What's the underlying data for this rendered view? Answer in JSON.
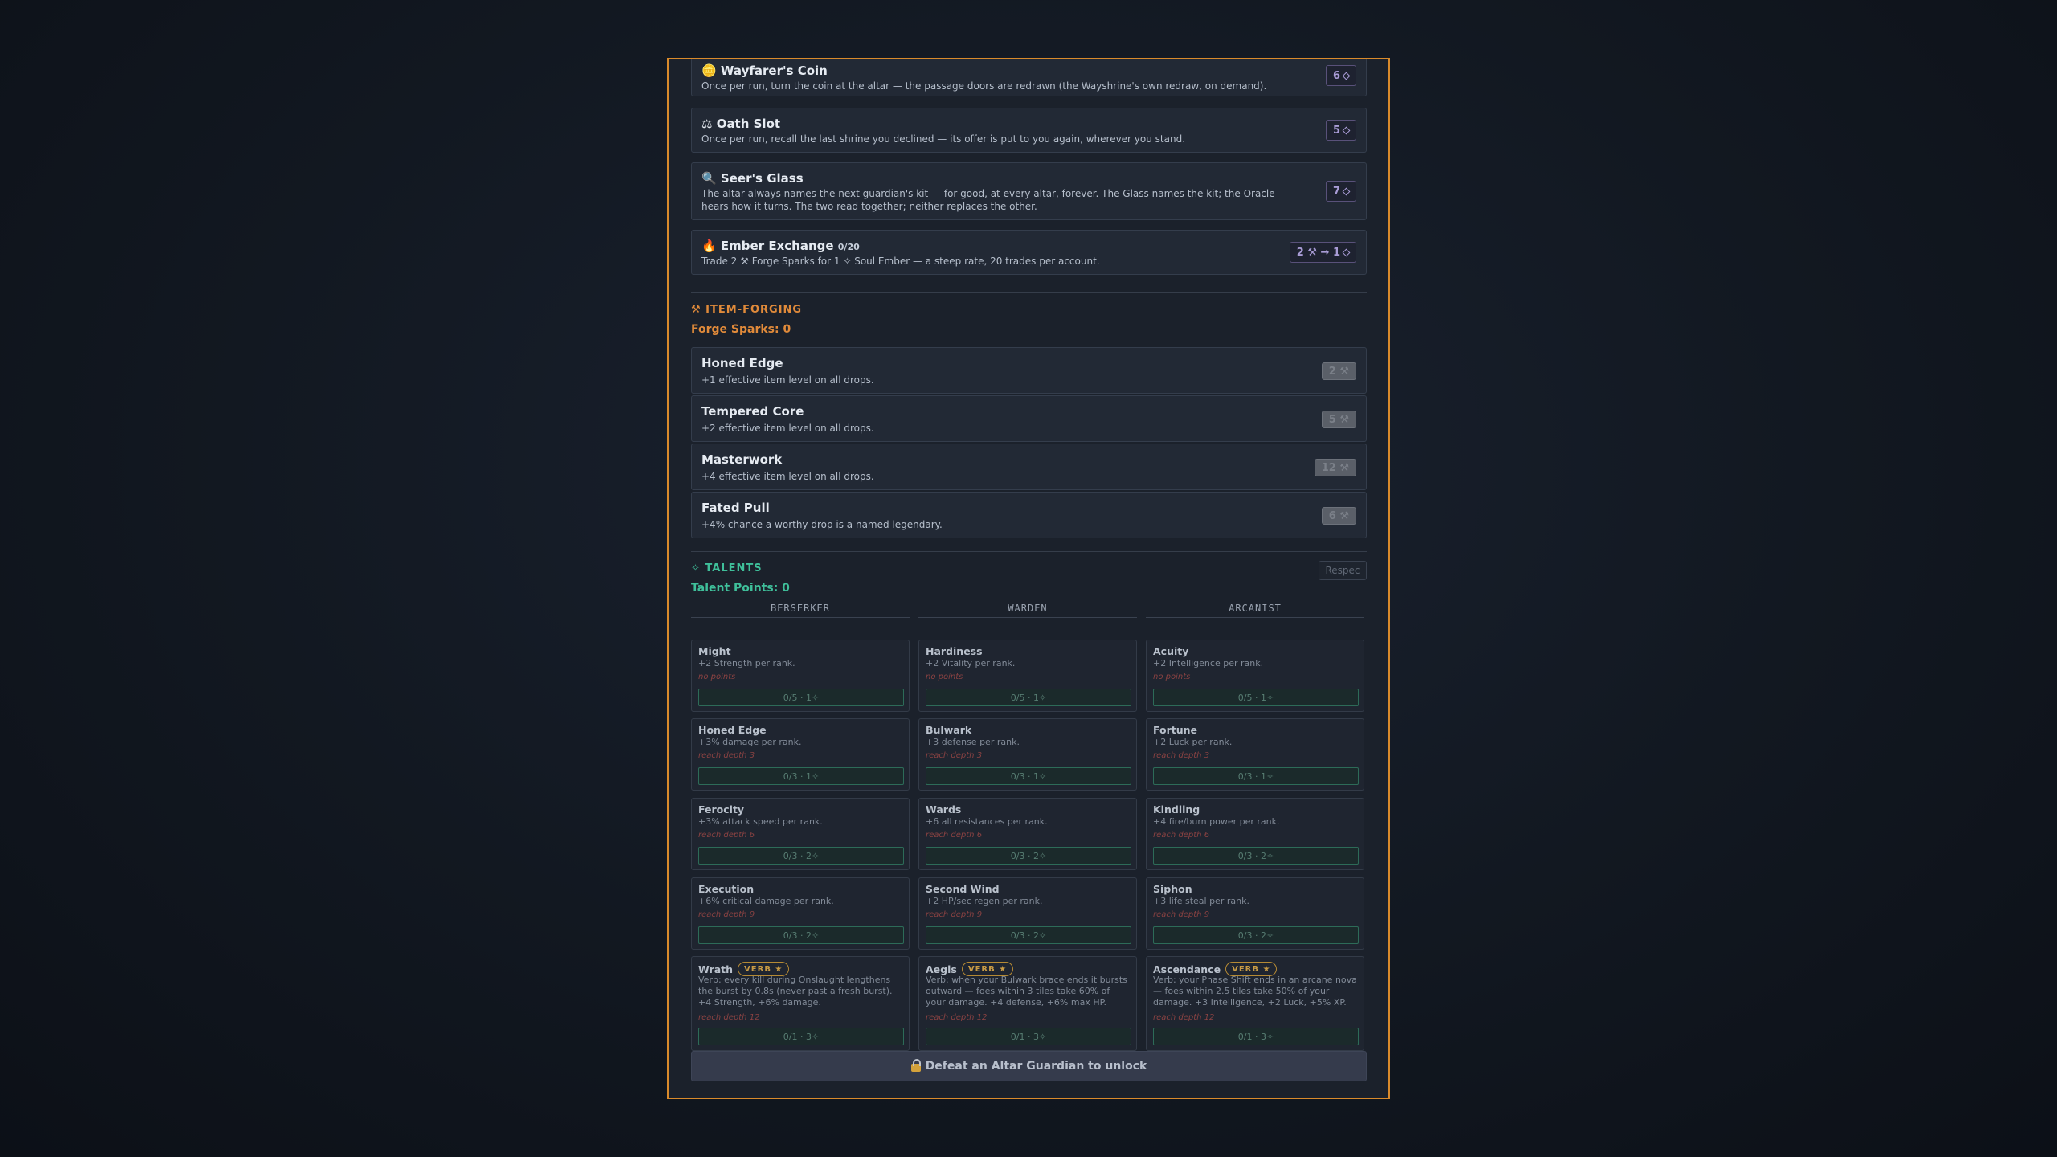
{
  "shrine": {
    "items": [
      {
        "icon": "🪙",
        "title": "Wayfarer's Coin",
        "count": "",
        "desc": "Once per run, turn the coin at the altar — the passage doors are redrawn (the Wayshrine's own redraw, on demand).",
        "cost": "6"
      },
      {
        "icon": "⚖",
        "title": "Oath Slot",
        "count": "",
        "desc": "Once per run, recall the last shrine you declined — its offer is put to you again, wherever you stand.",
        "cost": "5"
      },
      {
        "icon": "🔍",
        "title": "Seer's Glass",
        "count": "",
        "desc": "The altar always names the next guardian's kit — for good, at every altar, forever. The Glass names the kit; the Oracle hears how it turns. The two read together; neither replaces the other.",
        "cost": "7"
      },
      {
        "icon": "🔥",
        "title": "Ember Exchange",
        "count": "0/20",
        "desc": "Trade 2 ⚒ Forge Sparks for 1 ✧ Soul Ember — a steep rate, 20 trades per account.",
        "cost": "2 ⚒ → 1"
      }
    ]
  },
  "forging": {
    "heading": "⚒ ITEM-FORGING",
    "points": "Forge Sparks: 0",
    "items": [
      {
        "title": "Honed Edge",
        "desc": "+1 effective item level on all drops.",
        "cost": "2 ⚒"
      },
      {
        "title": "Tempered Core",
        "desc": "+2 effective item level on all drops.",
        "cost": "5 ⚒"
      },
      {
        "title": "Masterwork",
        "desc": "+4 effective item level on all drops.",
        "cost": "12 ⚒"
      },
      {
        "title": "Fated Pull",
        "desc": "+4% chance a worthy drop is a named legendary.",
        "cost": "6 ⚒"
      }
    ]
  },
  "talents": {
    "heading": "✧ TALENTS",
    "points": "Talent Points: 0",
    "respec": "Respec",
    "verb_badge": "VERB ★",
    "columns": [
      {
        "name": "BERSERKER",
        "items": [
          {
            "name": "Might",
            "desc": "+2 Strength per rank.",
            "req": "no points",
            "rank": "0/5 · 1✧"
          },
          {
            "name": "Honed Edge",
            "desc": "+3% damage per rank.",
            "req": "reach depth 3",
            "rank": "0/3 · 1✧"
          },
          {
            "name": "Ferocity",
            "desc": "+3% attack speed per rank.",
            "req": "reach depth 6",
            "rank": "0/3 · 2✧"
          },
          {
            "name": "Execution",
            "desc": "+6% critical damage per rank.",
            "req": "reach depth 9",
            "rank": "0/3 · 2✧"
          },
          {
            "name": "Wrath",
            "desc": "Verb: every kill during Onslaught lengthens the burst by 0.8s (never past a fresh burst). +4 Strength, +6% damage.",
            "req": "reach depth 12",
            "rank": "0/1 · 3✧"
          }
        ]
      },
      {
        "name": "WARDEN",
        "items": [
          {
            "name": "Hardiness",
            "desc": "+2 Vitality per rank.",
            "req": "no points",
            "rank": "0/5 · 1✧"
          },
          {
            "name": "Bulwark",
            "desc": "+3 defense per rank.",
            "req": "reach depth 3",
            "rank": "0/3 · 1✧"
          },
          {
            "name": "Wards",
            "desc": "+6 all resistances per rank.",
            "req": "reach depth 6",
            "rank": "0/3 · 2✧"
          },
          {
            "name": "Second Wind",
            "desc": "+2 HP/sec regen per rank.",
            "req": "reach depth 9",
            "rank": "0/3 · 2✧"
          },
          {
            "name": "Aegis",
            "desc": "Verb: when your Bulwark brace ends it bursts outward — foes within 3 tiles take 60% of your damage. +4 defense, +6% max HP.",
            "req": "reach depth 12",
            "rank": "0/1 · 3✧"
          }
        ]
      },
      {
        "name": "ARCANIST",
        "items": [
          {
            "name": "Acuity",
            "desc": "+2 Intelligence per rank.",
            "req": "no points",
            "rank": "0/5 · 1✧"
          },
          {
            "name": "Fortune",
            "desc": "+2 Luck per rank.",
            "req": "reach depth 3",
            "rank": "0/3 · 1✧"
          },
          {
            "name": "Kindling",
            "desc": "+4 fire/burn power per rank.",
            "req": "reach depth 6",
            "rank": "0/3 · 2✧"
          },
          {
            "name": "Siphon",
            "desc": "+3 life steal per rank.",
            "req": "reach depth 9",
            "rank": "0/3 · 2✧"
          },
          {
            "name": "Ascendance",
            "desc": "Verb: your Phase Shift ends in an arcane nova — foes within 2.5 tiles take 50% of your damage. +3 Intelligence, +2 Luck, +5% XP.",
            "req": "reach depth 12",
            "rank": "0/1 · 3✧"
          }
        ]
      }
    ]
  },
  "unlock_label": "Defeat an Altar Guardian to unlock",
  "colors": {
    "accent_border": "#d98a2b",
    "forging": "#e08a3a",
    "talents": "#3fbf9a",
    "soul": "#a99cd6"
  }
}
